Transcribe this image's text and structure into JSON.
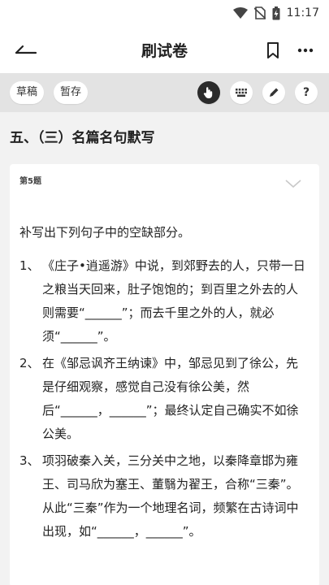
{
  "status_bar": {
    "time": "11:17",
    "icons": [
      "wifi-icon",
      "no-sim-icon",
      "battery-charging-icon"
    ]
  },
  "app_bar": {
    "back_icon": "back-arrow-icon",
    "title": "刷试卷",
    "bookmark_icon": "bookmark-icon",
    "more_icon": "more-icon"
  },
  "toolbar": {
    "draft_label": "草稿",
    "save_label": "暂存",
    "tools": [
      {
        "icon": "hand-pointer-icon",
        "active": true
      },
      {
        "icon": "keyboard-icon",
        "active": false
      },
      {
        "icon": "pencil-icon",
        "active": false
      },
      {
        "icon": "help-icon",
        "label": "?",
        "active": false
      }
    ]
  },
  "section": {
    "title": "五、（三）名篇名句默写"
  },
  "question": {
    "number_label": "第5题",
    "instruction": "补写出下列句子中的空缺部分。",
    "items": [
      {
        "num": "1、",
        "text": "《庄子•逍遥游》中说，到郊野去的人，只带一日之粮当天回来，肚子饱饱的；到百里之外去的人则需要“______”；而去千里之外的人，就必须“______”。"
      },
      {
        "num": "2、",
        "text": "在《邹忌讽齐王纳谏》中，邹忌见到了徐公，先是仔细观察，感觉自己没有徐公美，然后“______，______”；最终认定自己确实不如徐公美。"
      },
      {
        "num": "3、",
        "text": "项羽破秦入关，三分关中之地，以秦降章邯为雍王、司马欣为塞王、董翳为翟王，合称“三秦”。从此“三秦”作为一个地理名词，频繁在古诗词中出现，如“______，______”。"
      }
    ]
  },
  "colors": {
    "toolbar_bg": "#e3e3e3",
    "page_bg": "#f2f2f2",
    "active_tool": "#2b2b2b"
  }
}
